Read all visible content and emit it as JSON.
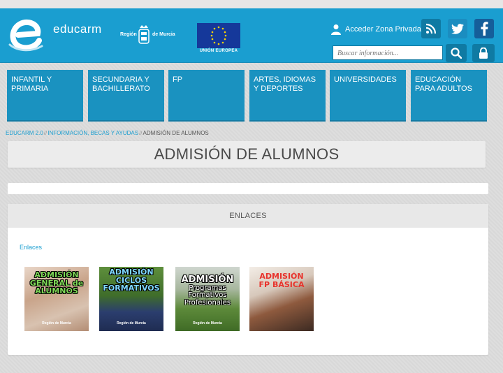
{
  "header": {
    "logo_text": "educarm",
    "region_left": "Región",
    "region_right": "de Murcia",
    "eu_label": "UNIÓN EUROPEA",
    "acceder_label": "Acceder Zona Privada",
    "search_placeholder": "Buscar información..."
  },
  "nav": [
    {
      "label": "INFANTIL Y PRIMARIA"
    },
    {
      "label": "SECUNDARIA Y BACHILLERATO"
    },
    {
      "label": "FP"
    },
    {
      "label": "ARTES, IDIOMAS Y DEPORTES"
    },
    {
      "label": "UNIVERSIDADES"
    },
    {
      "label": "EDUCACIÓN PARA ADULTOS"
    }
  ],
  "breadcrumb": {
    "items": [
      "EDUCARM 2.0",
      "INFORMACIÓN, BECAS Y AYUDAS",
      "ADMISIÓN DE ALUMNOS"
    ],
    "separator": "//"
  },
  "page_title": "ADMISIÓN DE ALUMNOS",
  "panel": {
    "heading": "ENLACES",
    "link_label": "Enlaces",
    "thumbs": [
      {
        "lines": [
          "ADMISIÓN",
          "GENERAL de",
          "ALUMNOS"
        ],
        "footer": "Región de Murcia"
      },
      {
        "lines": [
          "ADMISIÓN",
          "CICLOS",
          "FORMATIVOS"
        ],
        "footer": "Región de Murcia"
      },
      {
        "lines": [
          "ADMISIÓN",
          "Programas",
          "Formativos",
          "Profesionales"
        ],
        "footer": "Región de Murcia"
      },
      {
        "lines": [
          "ADMISIÓN",
          "FP BÁSICA"
        ],
        "footer": ""
      }
    ]
  },
  "colors": {
    "header_bg": "#1a9ed0",
    "nav_bg": "#1a92c0",
    "link": "#1a9ed0"
  }
}
